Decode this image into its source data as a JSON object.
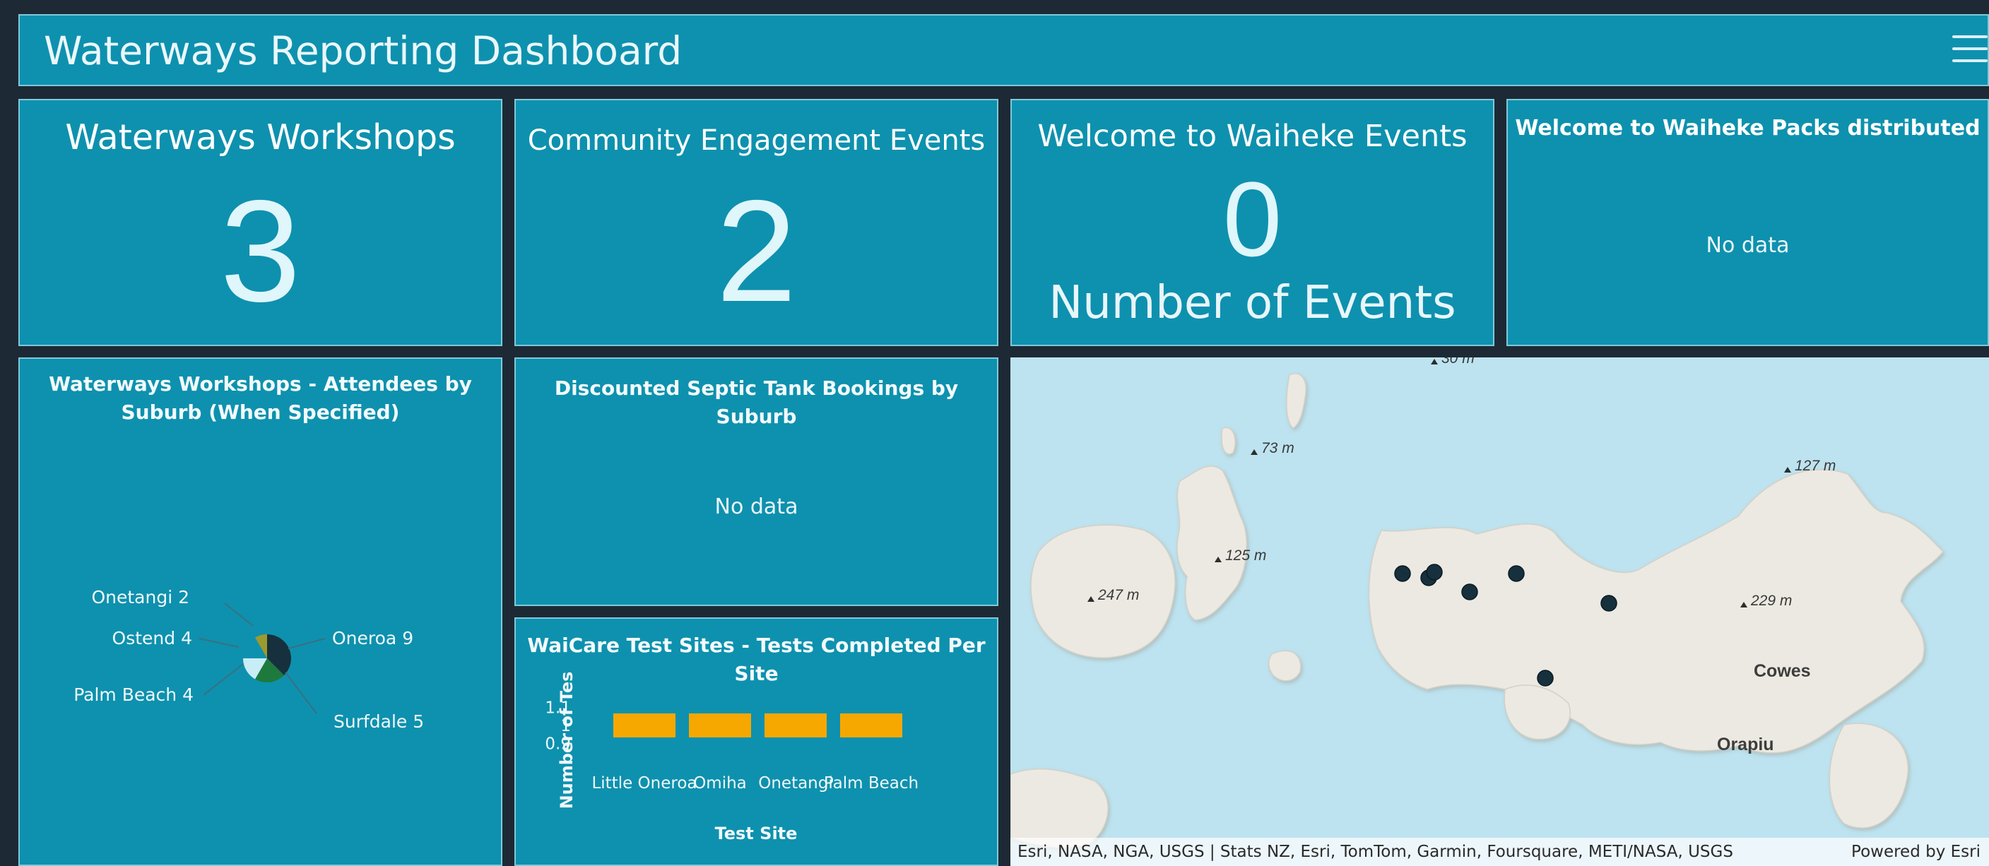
{
  "header": {
    "title": "Waterways Reporting Dashboard"
  },
  "indicators": [
    {
      "title": "Waterways Workshops",
      "value": "3"
    },
    {
      "title": "Community Engagement Events",
      "value": "2"
    },
    {
      "title": "Welcome to Waiheke Events",
      "value": "0",
      "bottom_text": "Number of Events"
    },
    {
      "title": "Welcome to Waiheke Packs distributed",
      "no_data": "No data"
    }
  ],
  "pie_panel": {
    "title_line1": "Waterways Workshops - Attendees by",
    "title_line2": "Suburb (When Specified)",
    "labels": {
      "onetangi": "Onetangi 2",
      "ostend": "Ostend 4",
      "palm_beach": "Palm Beach 4",
      "oneroa": "Oneroa 9",
      "surfdale": "Surfdale 5"
    }
  },
  "septic_panel": {
    "title": "Discounted Septic Tank Bookings by Suburb",
    "no_data": "No data"
  },
  "bar_panel": {
    "title": "WaiCare Test Sites - Tests Completed Per Site"
  },
  "map": {
    "labels": {
      "e1": "30 m",
      "e2": "73 m",
      "e3": "125 m",
      "e4": "247 m",
      "e5": "127 m",
      "e6": "229 m",
      "cowes": "Cowes",
      "orapiu": "Orapiu"
    },
    "attribution": "Esri, NASA, NGA, USGS | Stats NZ, Esri, TomTom, Garmin, Foursquare, METI/NASA, USGS",
    "powered_by": "Powered by Esri"
  },
  "colors": {
    "panel_bg": "#0e91ae",
    "page_bg": "#1d2a35",
    "bar": "#f7a800",
    "map_water": "#bde3f0",
    "map_land": "#ece9e2",
    "marker": "#17303d"
  },
  "chart_data": [
    {
      "type": "pie",
      "title": "Waterways Workshops - Attendees by Suburb (When Specified)",
      "categories": [
        "Oneroa",
        "Surfdale",
        "Palm Beach",
        "Ostend",
        "Onetangi"
      ],
      "values": [
        9,
        5,
        4,
        4,
        2
      ],
      "colors": [
        "#17303d",
        "#1e7a3c",
        "#c8edf6",
        "#0e91ae",
        "#9a9a2e"
      ]
    },
    {
      "type": "bar",
      "title": "WaiCare Test Sites - Tests Completed Per Site",
      "categories": [
        "Little Oneroa",
        "Omiha",
        "Onetangi",
        "Palm Beach"
      ],
      "values": [
        1,
        1,
        1,
        1
      ],
      "xlabel": "Test Site",
      "ylabel": "Number of Tes",
      "yticks": [
        "1.1",
        "1",
        "0.9"
      ],
      "ylim": [
        0.85,
        1.15
      ]
    }
  ]
}
